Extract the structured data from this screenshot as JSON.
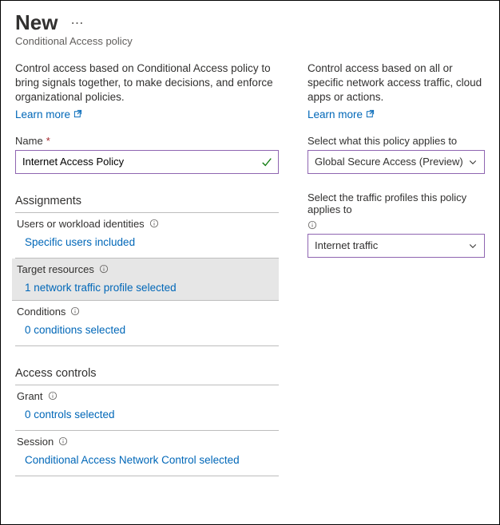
{
  "header": {
    "title": "New",
    "subtitle": "Conditional Access policy"
  },
  "left": {
    "description": "Control access based on Conditional Access policy to bring signals together, to make decisions, and enforce organizational policies.",
    "learn_more": "Learn more",
    "name_label": "Name",
    "name_value": "Internet Access Policy",
    "sections": {
      "assignments": "Assignments",
      "access_controls": "Access controls"
    },
    "rows": {
      "users": {
        "label": "Users or workload identities",
        "value": "Specific users included"
      },
      "target": {
        "label": "Target resources",
        "value": "1 network traffic profile selected"
      },
      "conditions": {
        "label": "Conditions",
        "value": "0 conditions selected"
      },
      "grant": {
        "label": "Grant",
        "value": "0 controls selected"
      },
      "session": {
        "label": "Session",
        "value": "Conditional Access Network Control selected"
      }
    }
  },
  "right": {
    "description": "Control access based on all or specific network access traffic, cloud apps or actions.",
    "learn_more": "Learn more",
    "applies_to_label": "Select what this policy applies to",
    "applies_to_value": "Global Secure Access (Preview)",
    "traffic_label": "Select the traffic profiles this policy applies to",
    "traffic_value": "Internet traffic"
  }
}
